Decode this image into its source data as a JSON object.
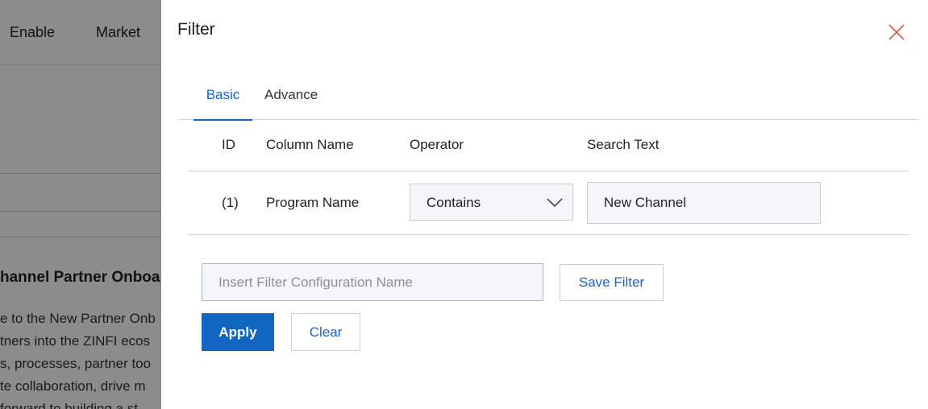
{
  "background": {
    "nav_items": [
      "Enable",
      "Market"
    ],
    "heading": "hannel Partner Onboa",
    "paragraph_lines": [
      "e to the New Partner Onb",
      "tners into the ZINFI ecos",
      "s, processes, partner too",
      "te collaboration, drive m",
      " forward to building a st"
    ]
  },
  "drawer": {
    "title": "Filter",
    "close_icon": "close-icon",
    "tabs": [
      {
        "label": "Basic",
        "active": true
      },
      {
        "label": "Advance",
        "active": false
      }
    ],
    "columns": {
      "id": "ID",
      "column_name": "Column Name",
      "operator": "Operator",
      "search_text": "Search Text"
    },
    "rows": [
      {
        "id": "(1)",
        "column_name": "Program Name",
        "operator": "Contains",
        "search_text": "New Channel"
      }
    ],
    "config_name": {
      "value": "",
      "placeholder": "Insert Filter Configuration Name"
    },
    "save_filter_label": "Save Filter",
    "apply_label": "Apply",
    "clear_label": "Clear"
  },
  "colors": {
    "accent": "#1a64c4",
    "primary_button": "#1166c2",
    "close_icon": "#d9534f",
    "input_bg": "#f4f6f9"
  }
}
